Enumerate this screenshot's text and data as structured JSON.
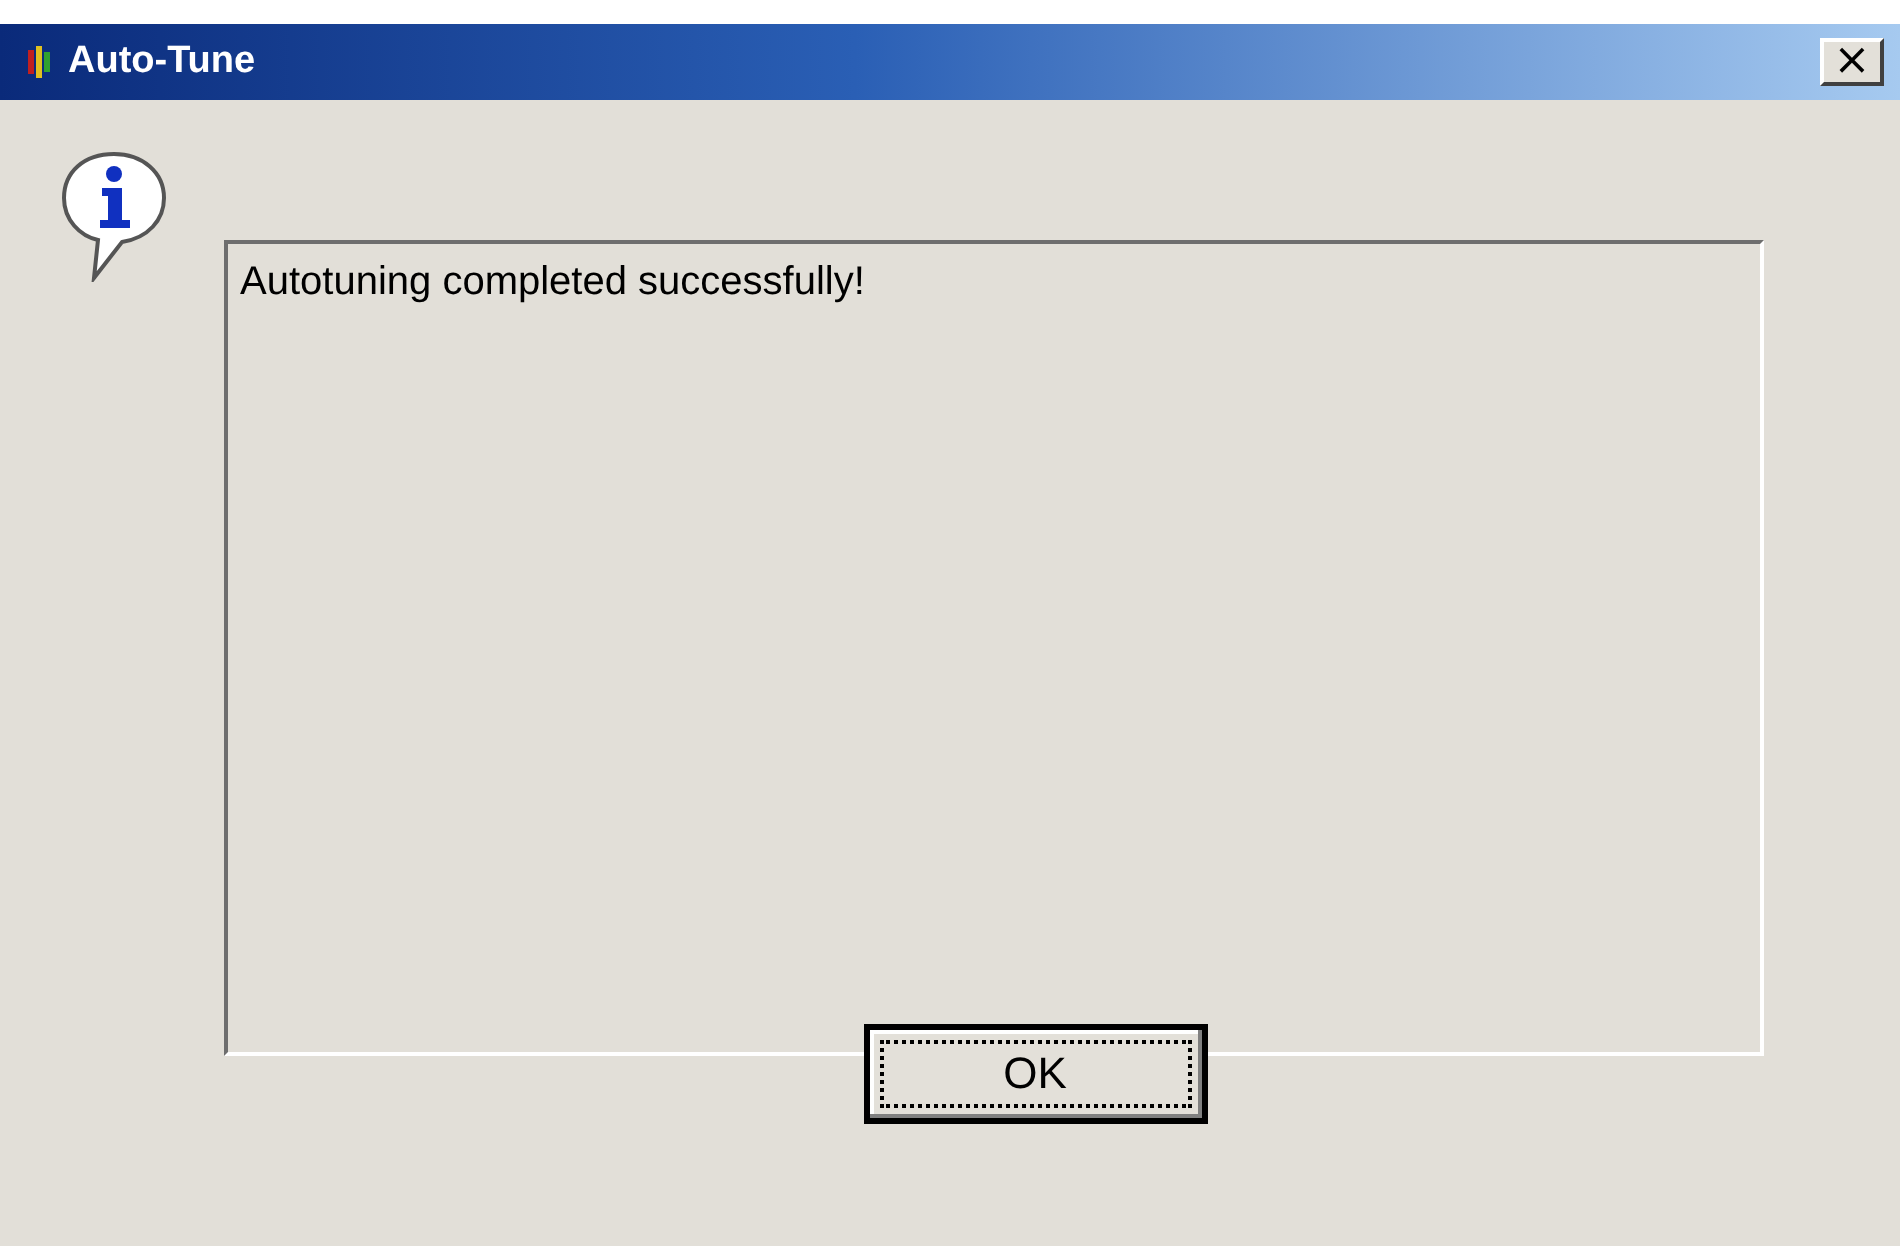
{
  "window": {
    "title": "Auto-Tune",
    "close": "×"
  },
  "message": {
    "text": "Autotuning completed successfully!"
  },
  "buttons": [
    {
      "label": "OK",
      "focused": true
    }
  ]
}
